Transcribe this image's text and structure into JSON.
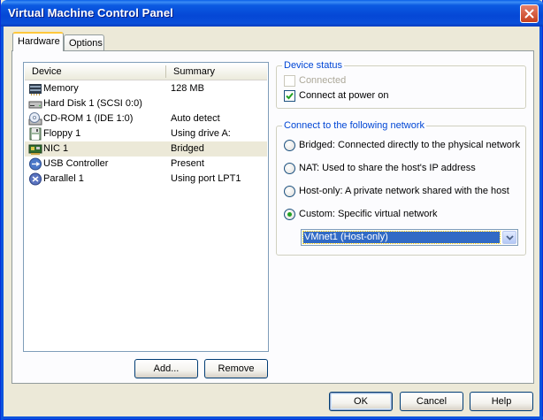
{
  "window": {
    "title": "Virtual Machine Control Panel"
  },
  "tabs": [
    {
      "label": "Hardware",
      "active": true
    },
    {
      "label": "Options",
      "active": false
    }
  ],
  "device_list": {
    "columns": [
      "Device",
      "Summary"
    ],
    "rows": [
      {
        "icon": "memory-icon",
        "name": "Memory",
        "summary": "128 MB",
        "selected": false
      },
      {
        "icon": "hard-disk-icon",
        "name": "Hard Disk 1 (SCSI 0:0)",
        "summary": "",
        "selected": false
      },
      {
        "icon": "cdrom-icon",
        "name": "CD-ROM 1 (IDE 1:0)",
        "summary": "Auto detect",
        "selected": false
      },
      {
        "icon": "floppy-icon",
        "name": "Floppy 1",
        "summary": "Using drive A:",
        "selected": false
      },
      {
        "icon": "nic-icon",
        "name": "NIC 1",
        "summary": "Bridged",
        "selected": true
      },
      {
        "icon": "usb-icon",
        "name": "USB Controller",
        "summary": "Present",
        "selected": false
      },
      {
        "icon": "parallel-port-icon",
        "name": "Parallel 1",
        "summary": "Using port LPT1",
        "selected": false
      }
    ]
  },
  "list_buttons": {
    "add": "Add...",
    "remove": "Remove"
  },
  "device_status": {
    "title": "Device status",
    "connected": {
      "label": "Connected",
      "checked": false,
      "enabled": false
    },
    "connect_at_power_on": {
      "label": "Connect at power on",
      "checked": true,
      "enabled": true
    }
  },
  "network": {
    "title": "Connect to the following network",
    "options": [
      {
        "label": "Bridged: Connected directly to the physical network",
        "selected": false
      },
      {
        "label": "NAT: Used to share the host's IP address",
        "selected": false
      },
      {
        "label": "Host-only: A private network shared with the host",
        "selected": false
      },
      {
        "label": "Custom: Specific virtual network",
        "selected": true
      }
    ],
    "custom_select": {
      "value": "VMnet1 (Host-only)"
    }
  },
  "dialog_buttons": {
    "ok": "OK",
    "cancel": "Cancel",
    "help": "Help"
  },
  "colors": {
    "titlebar": "#0a4fd9",
    "group_title": "#0046d5",
    "selection": "#316ac5",
    "radio_dot": "#21a121"
  }
}
